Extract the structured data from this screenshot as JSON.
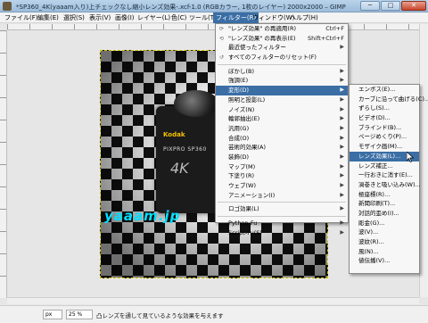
{
  "window": {
    "title": "*SP360_4K(yaaam入り)上チェックなし縮小レンズ効果-.xcf-1.0 (RGBカラー, 1枚のレイヤー) 2000x2000 – GIMP",
    "minimize": "─",
    "maximize": "□",
    "close": "✕"
  },
  "menubar": [
    "ファイル(F)",
    "編集(E)",
    "選択(S)",
    "表示(V)",
    "画像(I)",
    "レイヤー(L)",
    "色(C)",
    "ツール(T)",
    "フィルター(R)",
    "ウィンドウ(W)",
    "ヘルプ(H)"
  ],
  "image": {
    "brand": "Kodak",
    "model": "PIXPRO SP360",
    "resolution_badge": "4K",
    "watermark": "yaaam.jp"
  },
  "filters_menu": {
    "top": [
      {
        "label": "\"レンズ効果\" の再適用(R)",
        "shortcut": "Ctrl+F",
        "icon": "reapply-icon"
      },
      {
        "label": "\"レンズ効果\" の再表示(E)",
        "shortcut": "Shift+Ctrl+F",
        "icon": "reshow-icon"
      },
      {
        "label": "最近使ったフィルター",
        "shortcut": "",
        "arrow": "▶"
      },
      {
        "label": "すべてのフィルターのリセット(F)",
        "shortcut": "",
        "icon": "reset-icon"
      }
    ],
    "groups": [
      {
        "label": "ぼかし(B)",
        "arrow": "▶"
      },
      {
        "label": "強調(E)",
        "arrow": "▶"
      },
      {
        "label": "変形(D)",
        "arrow": "▶",
        "highlighted": true
      },
      {
        "label": "照明と投影(L)",
        "arrow": "▶"
      },
      {
        "label": "ノイズ(N)",
        "arrow": "▶"
      },
      {
        "label": "輪郭抽出(E)",
        "arrow": "▶"
      },
      {
        "label": "汎用(G)",
        "arrow": "▶"
      },
      {
        "label": "合成(O)",
        "arrow": "▶"
      },
      {
        "label": "芸術的効果(A)",
        "arrow": "▶"
      },
      {
        "label": "装飾(D)",
        "arrow": "▶"
      },
      {
        "label": "マップ(M)",
        "arrow": "▶"
      },
      {
        "label": "下塗り(R)",
        "arrow": "▶"
      },
      {
        "label": "ウェブ(W)",
        "arrow": "▶"
      },
      {
        "label": "アニメーション(I)",
        "arrow": "▶"
      }
    ],
    "bottom": [
      {
        "label": "ロゴ効果(L)",
        "arrow": "▶"
      },
      {
        "label": "Python-Fu",
        "arrow": "▶"
      },
      {
        "label": "Script-Fu(S)",
        "arrow": "▶"
      }
    ]
  },
  "distorts_submenu": [
    {
      "label": "エンボス(E)..."
    },
    {
      "label": "カーブに沿って曲げる(C)..."
    },
    {
      "label": "ずらし(S)..."
    },
    {
      "label": "ビデオ(D)..."
    },
    {
      "label": "ブラインド(B)..."
    },
    {
      "label": "ページめくり(P)..."
    },
    {
      "label": "モザイク画(M)..."
    },
    {
      "label": "レンズ効果(L)...",
      "highlighted": true
    },
    {
      "label": "レンズ補正..."
    },
    {
      "label": "一行おきに消す(E)..."
    },
    {
      "label": "渦巻きと吸い込み(W)..."
    },
    {
      "label": "極座標(R)..."
    },
    {
      "label": "新聞印刷(T)..."
    },
    {
      "label": "対話的歪め(I)..."
    },
    {
      "label": "彫金(G)..."
    },
    {
      "label": "波(V)..."
    },
    {
      "label": "波紋(R)..."
    },
    {
      "label": "風(N)..."
    },
    {
      "label": "値伝播(V)..."
    }
  ],
  "statusbar": {
    "unit": "px",
    "zoom": "25 %",
    "message": "凸レンズを通して見ているような効果を与えます"
  }
}
